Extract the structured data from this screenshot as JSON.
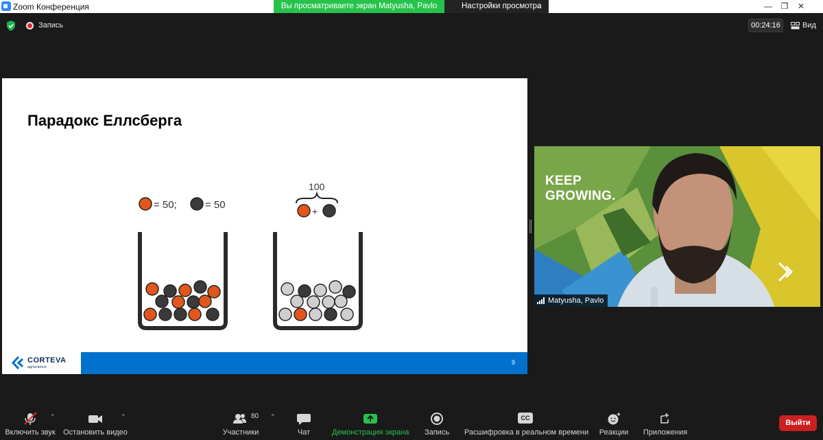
{
  "window": {
    "title": "Zoom Конференция",
    "share_banner": "Вы просматриваете экран Matyusha, Pavlo",
    "view_settings": "Настройки просмотра"
  },
  "topbar": {
    "recording_label": "Запись",
    "timer": "00:24:16",
    "view_label": "Вид"
  },
  "slide": {
    "title": "Парадокс Еллсберга",
    "legend_orange_value": "= 50;",
    "legend_dark_value": "= 50",
    "total_label": "100",
    "plus_sign": "+",
    "brand": "CORTEVA",
    "brand_sub": "agriscience",
    "page_number": "9"
  },
  "video": {
    "overlay_line1": "KEEP",
    "overlay_line2": "GROWING.",
    "participant_name": "Matyusha, Pavlo"
  },
  "toolbar": {
    "unmute": "Включить звук",
    "stop_video": "Остановить видео",
    "participants": "Участники",
    "participants_count": "80",
    "chat": "Чат",
    "share_screen": "Демонстрация экрана",
    "record": "Запись",
    "captions": "Расшифровка в реальном времени",
    "captions_badge": "CC",
    "reactions": "Реакции",
    "apps": "Приложения",
    "leave": "Выйти"
  },
  "colors": {
    "share_green": "#27c24c",
    "leave_red": "#cc2020",
    "corteva_blue": "#0072ce",
    "ball_orange": "#e0561c",
    "ball_dark": "#3a3a3a"
  }
}
